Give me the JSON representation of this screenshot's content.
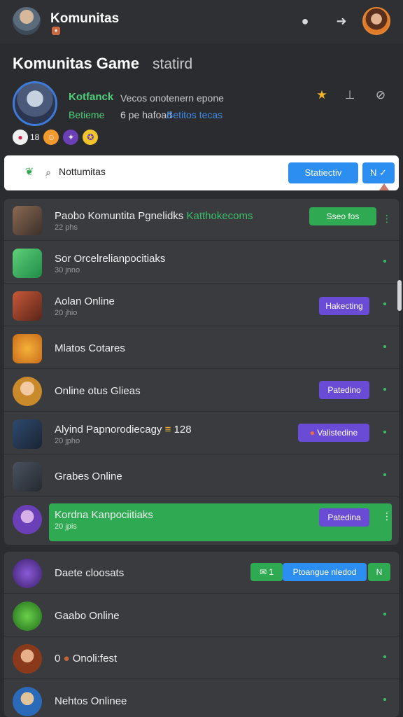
{
  "topbar": {
    "title": "Komunitas",
    "icons": [
      "user-avatar",
      "badge-icon",
      "mic-icon",
      "share-arrow-icon",
      "profile-avatar"
    ]
  },
  "community": {
    "heading": "Komunitas Game",
    "heading_sub": "statird",
    "name": "Kotfanck",
    "description": "Vecos onotenern epone",
    "status": "Betieme",
    "note": "6 pe hafoad",
    "link": "Betitos tecas",
    "reactions_count": "18"
  },
  "search": {
    "placeholder": "Nottumitas",
    "select_label": "Statiectiv",
    "small_label": "N ✓"
  },
  "games_primary": [
    {
      "title": "Paobo Komuntita Pgnelidks",
      "title_extra": "Katthokecoms",
      "subtitle": "22 phs",
      "badge": "Sseo fos",
      "badge_color": "green"
    },
    {
      "title": "Sor Orcelrelianpocitiaks",
      "subtitle": "30 jnno",
      "badge": ""
    },
    {
      "title": "Aolan Online",
      "subtitle": "20 jhio",
      "badge": "Hakecting",
      "badge_color": "purple"
    },
    {
      "title": "Mlatos Cotares",
      "subtitle": "",
      "badge": ""
    },
    {
      "title": "Online otus Glieas",
      "subtitle": "",
      "badge": "Patedino",
      "badge_color": "purple"
    },
    {
      "title": "Alyind Papnorodiecagy",
      "title_extra": "128",
      "subtitle": "20 jpho",
      "badge": "Valistedine",
      "badge_color": "purple"
    },
    {
      "title": "Grabes Online",
      "subtitle": "",
      "badge": ""
    },
    {
      "title": "Kordna Kanpociitiaks",
      "subtitle": "20 jpis",
      "badge": "Patedina",
      "badge_color": "purple",
      "highlight": true
    }
  ],
  "games_secondary": [
    {
      "title": "Daete cloosats",
      "subtitle": "",
      "badge_count": "1",
      "badge": "Ptoangue nledod",
      "badge_extra": "N"
    },
    {
      "title": "Gaabo Online",
      "subtitle": "",
      "badge": ""
    },
    {
      "title": "0",
      "title_extra": "Onoli:fest",
      "subtitle": "",
      "badge": ""
    },
    {
      "title": "Nehtos Onlinee",
      "subtitle": "",
      "badge": ""
    }
  ],
  "colors": {
    "accent_green": "#2fa952",
    "accent_blue": "#2b8ef0",
    "accent_purple": "#6a4bd6",
    "background": "#2b2c2f"
  }
}
